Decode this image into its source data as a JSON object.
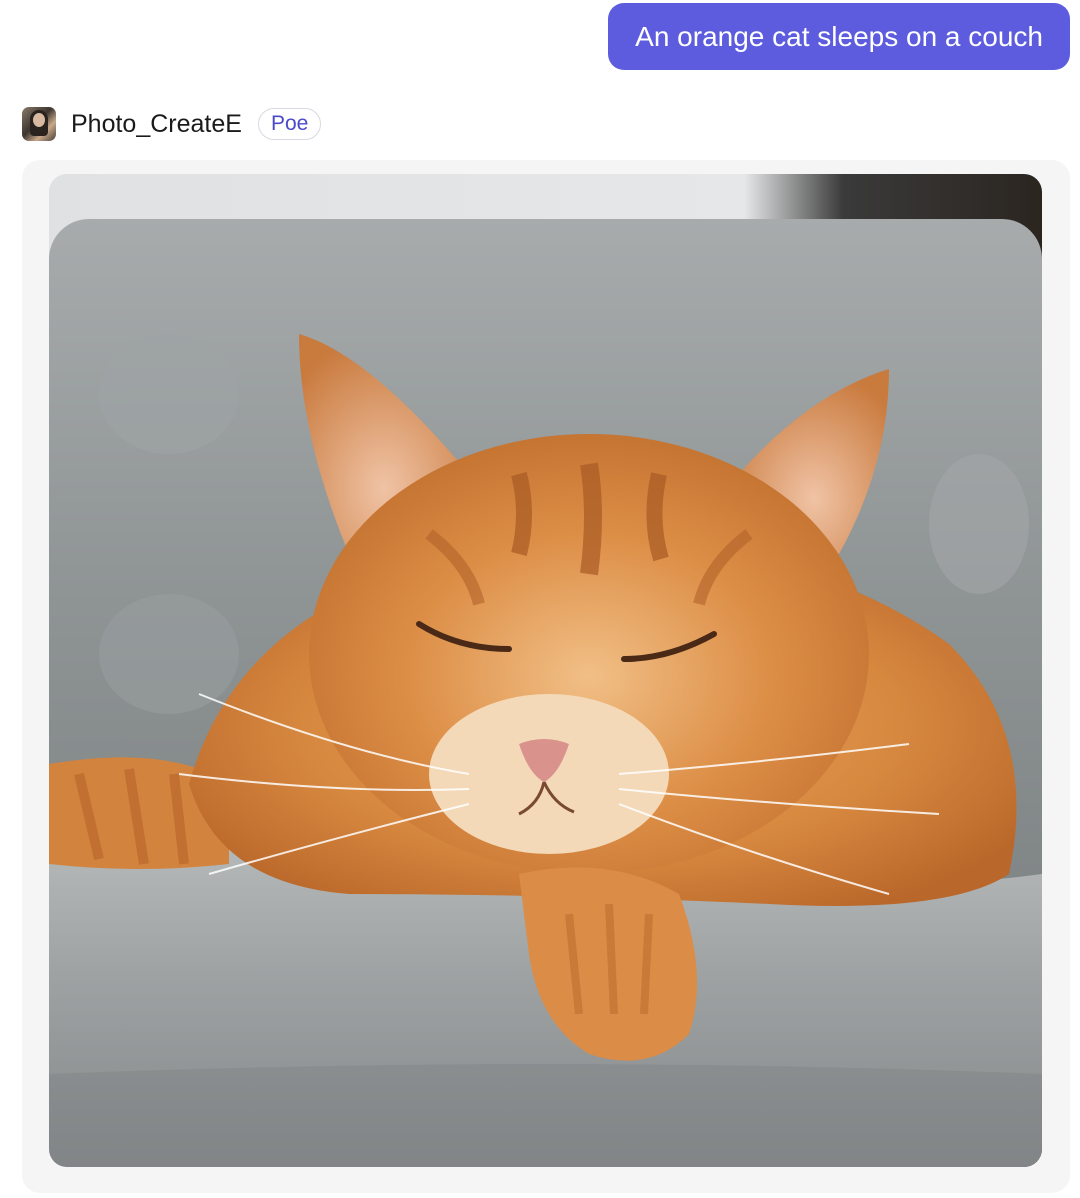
{
  "user_message": {
    "text": "An orange cat sleeps on a couch",
    "bubble_color": "#5d5cde"
  },
  "bot": {
    "name": "Photo_CreateE",
    "badge": "Poe",
    "avatar_icon": "bot-avatar-icon"
  },
  "generated_image": {
    "kind": "photo",
    "subject": "orange-cat-sleeping-on-gray-couch"
  },
  "colors": {
    "accent": "#5d5cde",
    "badge_text": "#4b4acb",
    "card_bg": "#f5f5f6"
  }
}
